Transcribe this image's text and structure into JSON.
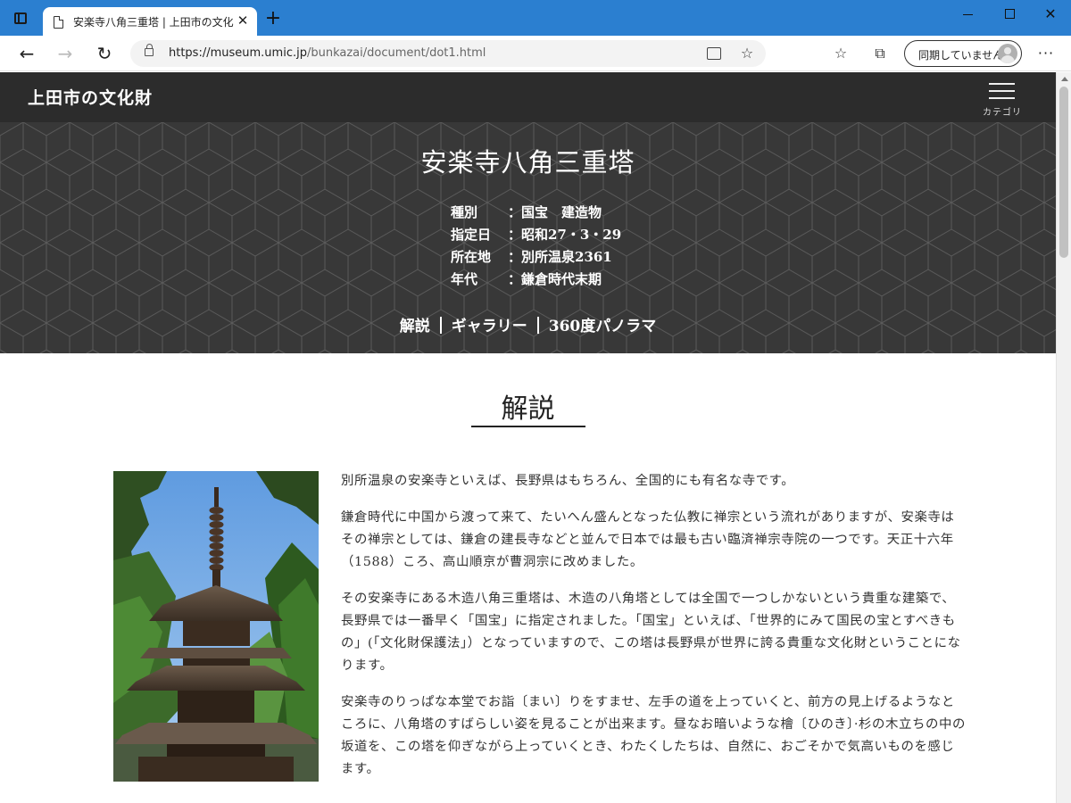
{
  "browser": {
    "tab_title": "安楽寺八角三重塔 | 上田市の文化",
    "tab_close": "✕",
    "new_tab": "+",
    "url_domain": "https://museum.umic.jp",
    "url_path": "/bunkazai/document/dot1.html",
    "profile_label": "同期していません",
    "menu": "···",
    "window_close": "✕"
  },
  "site": {
    "title": "上田市の文化財",
    "menu_label": "カテゴリ"
  },
  "hero": {
    "title": "安楽寺八角三重塔",
    "meta": [
      {
        "key": "種別",
        "value": "：国宝　建造物"
      },
      {
        "key": "指定日",
        "value": "：昭和27・3・29"
      },
      {
        "key": "所在地",
        "value": "：別所温泉2361"
      },
      {
        "key": "年代",
        "value": "：鎌倉時代末期"
      }
    ],
    "nav": [
      "解説",
      "ギャラリー",
      "360度パノラマ"
    ]
  },
  "section": {
    "title": "解説"
  },
  "article": {
    "paragraphs": [
      "別所温泉の安楽寺といえば、長野県はもちろん、全国的にも有名な寺です。",
      "鎌倉時代に中国から渡って来て、たいへん盛んとなった仏教に禅宗という流れがありますが、安楽寺はその禅宗としては、鎌倉の建長寺などと並んで日本では最も古い臨済禅宗寺院の一つです。天正十六年（1588）ころ、高山順京が曹洞宗に改めました。",
      "その安楽寺にある木造八角三重塔は、木造の八角塔としては全国で一つしかないという貴重な建築で、長野県では一番早く「国宝」に指定されました。「国宝」といえば、「世界的にみて国民の宝とすべきもの」(「文化財保護法」）となっていますので、この塔は長野県が世界に誇る貴重な文化財ということになります。",
      "安楽寺のりっぱな本堂でお詣〔まい〕りをすませ、左手の道を上っていくと、前方の見上げるようなところに、八角塔のすばらしい姿を見ることが出来ます。昼なお暗いような檜〔ひのき〕·杉の木立ちの中の坂道を、この塔を仰ぎながら上っていくとき、わたくしたちは、自然に、おごそかで気高いものを感じます。"
    ]
  },
  "colors": {
    "titlebar": "#2b7fd0",
    "header": "#2c2c2c",
    "hero": "#383838"
  }
}
